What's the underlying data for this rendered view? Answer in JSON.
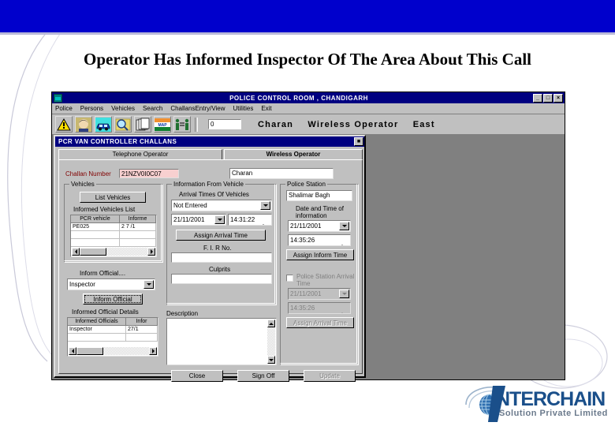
{
  "slide": {
    "title": "Operator Has Informed Inspector Of The Area About This Call"
  },
  "app_window": {
    "title": "POLICE CONTROL ROOM , CHANDIGARH",
    "minimize_label": "_",
    "maximize_label": "□",
    "close_label": "×",
    "menu": [
      "Police",
      "Persons",
      "Vehicles",
      "Search",
      "ChallansEntry/View",
      "Utilities",
      "Exit"
    ],
    "toolbar": {
      "icons": [
        "alert-triangle-icon",
        "person-photo-icon",
        "car-icon",
        "magnifier-map-icon",
        "files-icon",
        "map-flag-icon",
        "persons-exchange-icon"
      ],
      "counter_value": "0",
      "status": [
        "Charan",
        "Wireless Operator",
        "East"
      ]
    }
  },
  "child_window": {
    "title": "PCR VAN CONTROLLER CHALLANS",
    "restore_label": "■",
    "tabs": [
      {
        "label": "Telephone Operator",
        "selected": false
      },
      {
        "label": "Wireless Operator",
        "selected": true
      }
    ],
    "challan": {
      "label": "Challan Number",
      "value": "21NZV0I0C07"
    },
    "operator_name": {
      "value": "Charan"
    },
    "vehicles_group": {
      "legend": "Vehicles",
      "list_vehicles_button": "List Vehicles",
      "informed_list_label": "Informed Vehicles List",
      "grid": {
        "columns": [
          "PCR vehicle",
          "Informe"
        ],
        "rows": [
          [
            "PE025",
            "2 7 /1"
          ]
        ]
      }
    },
    "inform_official": {
      "label": "Inform Official....",
      "selected": "Inspector",
      "button": "Inform Official",
      "details_label": "Informed Official Details",
      "grid": {
        "columns": [
          "Informed Officials",
          "Infor"
        ],
        "rows": [
          [
            "Inspector",
            "27/1"
          ]
        ]
      }
    },
    "information_from_vehicle": {
      "legend": "Information From Vehicle",
      "arrival_times_label": "Arrival Times Of Vehicles",
      "arrival_selected": "Not Entered",
      "arrival_date": "21/11/2001",
      "arrival_time": "14:31:22",
      "assign_arrival_button": "Assign Arrival Time",
      "fir_label": "F. I. R No.",
      "fir_value": "",
      "culprits_label": "Culprits",
      "culprits_value": ""
    },
    "description": {
      "label": "Description",
      "value": ""
    },
    "police_station": {
      "legend": "Police Station",
      "name_value": "Shalimar Bagh",
      "datetime_label": "Date and Time of information",
      "date": "21/11/2001",
      "time": "14:35:26",
      "assign_inform_button": "Assign Inform Time",
      "arrival_checkbox_label": "Police Station Arrival Time",
      "arrival_checked": false,
      "arrival_date": "21/11/2001",
      "arrival_time": "14:35:26",
      "assign_arrival_button": "Assign Arrival Time"
    },
    "footer_buttons": [
      {
        "label": "Close",
        "enabled": true
      },
      {
        "label": "Sign Off",
        "enabled": true
      },
      {
        "label": "Update",
        "enabled": false
      }
    ]
  },
  "logo": {
    "name": "NTERCHAIN",
    "tagline": "Solution Private Limited",
    "accent": "#1a4f8a"
  }
}
